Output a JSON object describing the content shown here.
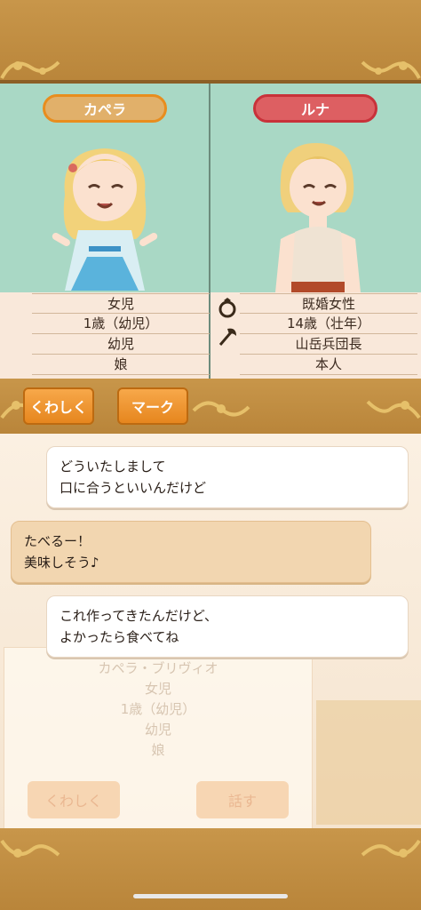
{
  "left_character": {
    "name": "カペラ",
    "info": [
      "女児",
      "1歳（幼児）",
      "幼児",
      "娘"
    ]
  },
  "right_character": {
    "name": "ルナ",
    "info": [
      "既婚女性",
      "14歳（壮年）",
      "山岳兵団長",
      "本人"
    ]
  },
  "info_icons": [
    "ring-icon",
    "axe-icon"
  ],
  "actions": {
    "details_label": "くわしく",
    "mark_label": "マーク"
  },
  "chat": {
    "messages": [
      {
        "speaker": "right",
        "lines": [
          "どういたしまして",
          "口に合うといいんだけど"
        ]
      },
      {
        "speaker": "left",
        "lines": [
          "たべるー！",
          "美味しそう♪"
        ]
      },
      {
        "speaker": "right",
        "lines": [
          "これ作ってきたんだけど、",
          "よかったら食べてね"
        ]
      }
    ]
  },
  "background_card": {
    "rows": [
      "カペラ・ブリヴィオ",
      "女児",
      "1歳（幼児）",
      "幼児",
      "娘"
    ],
    "details_label": "くわしく",
    "talk_label": "話す"
  },
  "colors": {
    "frame": "#c8964a",
    "portrait_bg": "#a9d8c5",
    "name_pill_orange": "#e1b06a",
    "name_pill_red": "#dd5f62",
    "button_orange": "#f09a34"
  }
}
